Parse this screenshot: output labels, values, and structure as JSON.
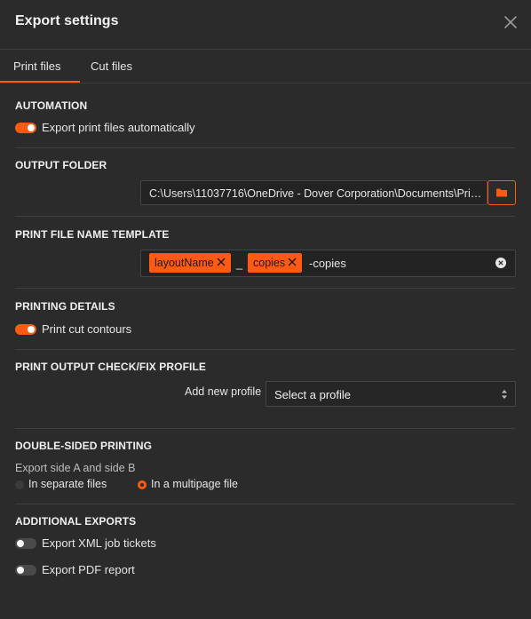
{
  "dialog": {
    "title": "Export settings",
    "close_icon": "close-icon"
  },
  "tabs": [
    {
      "label": "Print files",
      "active": true
    },
    {
      "label": "Cut files",
      "active": false
    }
  ],
  "automation": {
    "title": "AUTOMATION",
    "toggle_label": "Export print files automatically",
    "toggle_on": true
  },
  "output_folder": {
    "title": "OUTPUT FOLDER",
    "path": "C:\\Users\\11037716\\OneDrive - Dover Corporation\\Documents\\Prim...",
    "browse_icon": "folder-icon"
  },
  "template": {
    "title": "PRINT FILE NAME TEMPLATE",
    "chips": [
      "layoutName",
      "copies"
    ],
    "separator": "_",
    "suffix": "-copies",
    "clear_icon": "clear-circle-icon"
  },
  "printing_details": {
    "title": "PRINTING DETAILS",
    "toggle_label": "Print cut contours",
    "toggle_on": true
  },
  "check_fix": {
    "title": "PRINT OUTPUT CHECK/FIX PROFILE",
    "add_label": "Add new profile",
    "select_value": "Select a profile"
  },
  "double_sided": {
    "title": "DOUBLE-SIDED PRINTING",
    "subtitle": "Export side A and side B",
    "options": [
      {
        "label": "In separate files",
        "selected": false
      },
      {
        "label": "In a multipage file",
        "selected": true
      }
    ]
  },
  "additional": {
    "title": "ADDITIONAL EXPORTS",
    "items": [
      {
        "label": "Export XML job tickets",
        "on": false
      },
      {
        "label": "Export PDF report",
        "on": false
      }
    ]
  },
  "colors": {
    "accent": "#ff5a14",
    "background": "#2b2b2b",
    "text": "#e6e6e6"
  }
}
